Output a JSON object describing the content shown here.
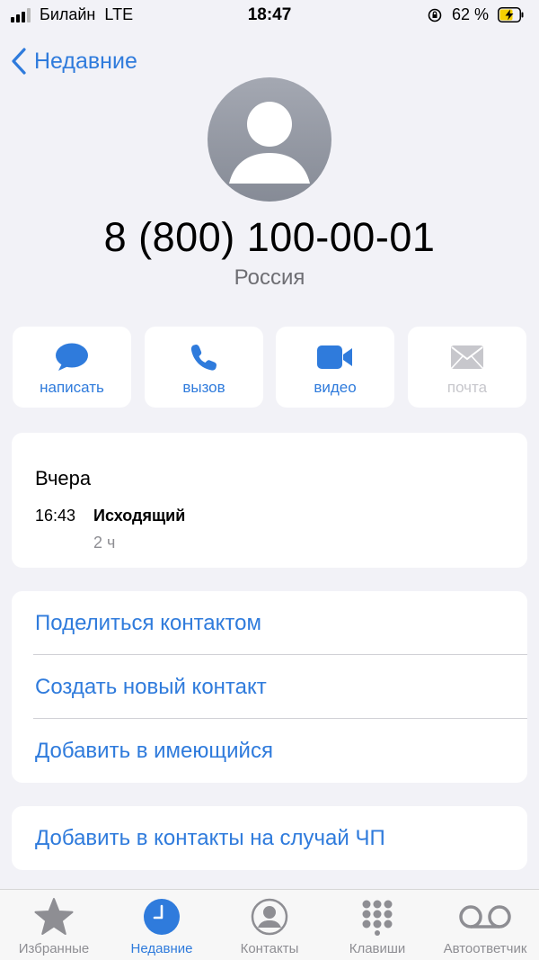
{
  "status_bar": {
    "carrier": "Билайн",
    "network": "LTE",
    "time": "18:47",
    "battery": "62 %"
  },
  "nav": {
    "back_label": "Недавние"
  },
  "contact": {
    "number": "8 (800) 100-00-01",
    "country": "Россия"
  },
  "actions": [
    {
      "label": "написать",
      "icon": "message-icon",
      "enabled": true
    },
    {
      "label": "вызов",
      "icon": "phone-icon",
      "enabled": true
    },
    {
      "label": "видео",
      "icon": "video-icon",
      "enabled": true
    },
    {
      "label": "почта",
      "icon": "mail-icon",
      "enabled": false
    }
  ],
  "recent_calls": {
    "date": "Вчера",
    "time": "16:43",
    "type": "Исходящий",
    "duration": "2 ч"
  },
  "options": [
    {
      "label": "Поделиться контактом"
    },
    {
      "label": "Создать новый контакт"
    },
    {
      "label": "Добавить в имеющийся"
    }
  ],
  "emergency": {
    "label": "Добавить в контакты на случай ЧП"
  },
  "tabs": [
    {
      "label": "Избранные",
      "icon": "star-icon",
      "active": false
    },
    {
      "label": "Недавние",
      "icon": "clock-icon",
      "active": true
    },
    {
      "label": "Контакты",
      "icon": "contact-icon",
      "active": false
    },
    {
      "label": "Клавиши",
      "icon": "keypad-icon",
      "active": false
    },
    {
      "label": "Автоответчик",
      "icon": "voicemail-icon",
      "active": false
    }
  ],
  "colors": {
    "accent": "#2f7bdc",
    "background": "#f2f2f7",
    "disabled": "#c7c7cc"
  }
}
